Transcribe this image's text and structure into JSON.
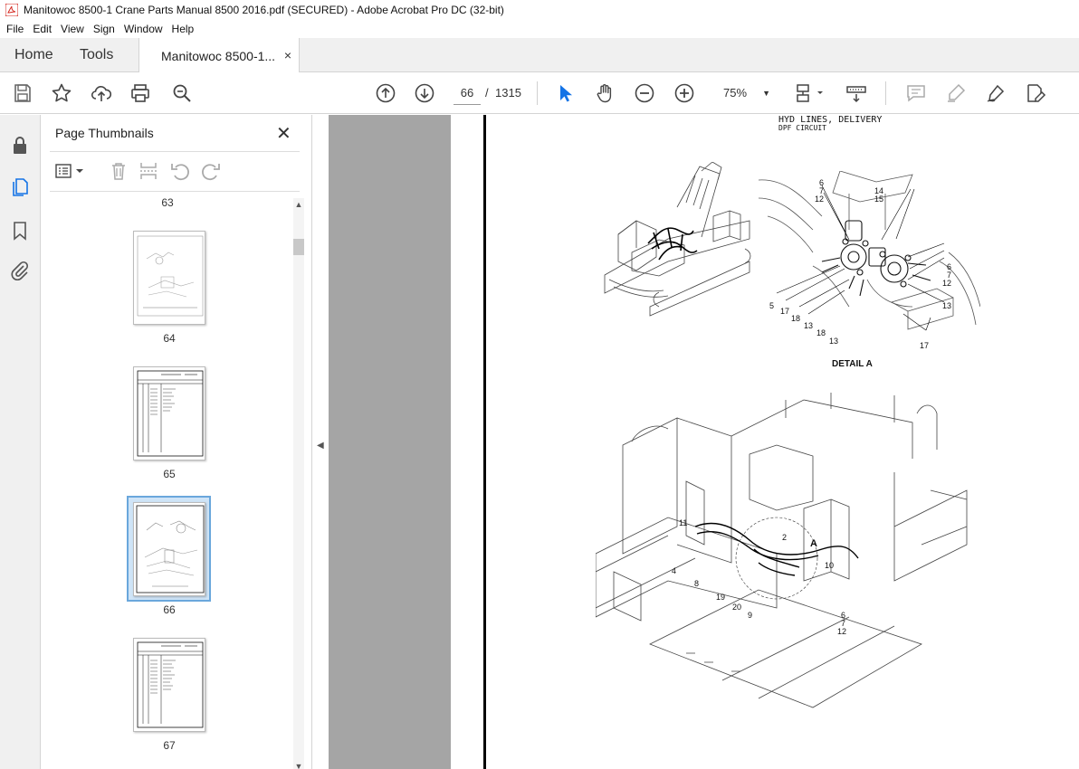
{
  "window": {
    "title": "Manitowoc 8500-1 Crane Parts Manual 8500 2016.pdf (SECURED) - Adobe Acrobat Pro DC (32-bit)"
  },
  "menu": [
    "File",
    "Edit",
    "View",
    "Sign",
    "Window",
    "Help"
  ],
  "tabs": {
    "home": "Home",
    "tools": "Tools",
    "document": "Manitowoc 8500-1...",
    "close_glyph": "×"
  },
  "toolbar": {
    "current_page": "66",
    "separator": "/",
    "total_pages": "1315",
    "zoom": "75%",
    "icons": [
      "save-icon",
      "star-icon",
      "upload-icon",
      "print-icon",
      "zoom-search-icon",
      "page-up-icon",
      "page-down-icon",
      "select-arrow-icon",
      "hand-icon",
      "zoom-out-icon",
      "zoom-in-icon",
      "page-display-icon",
      "scroll-mode-icon",
      "comment-icon",
      "highlight-icon",
      "sign-icon",
      "edit-pdf-icon"
    ]
  },
  "left_rail": {
    "icons": [
      "lock-icon",
      "page-thumbnails-icon",
      "bookmark-icon",
      "attachment-icon"
    ]
  },
  "thumbnail_panel": {
    "title": "Page Thumbnails",
    "close_glyph": "✕",
    "pages": [
      {
        "label": "63",
        "kind": "label-only"
      },
      {
        "label": "64",
        "kind": "drawing"
      },
      {
        "label": "65",
        "kind": "table"
      },
      {
        "label": "66",
        "kind": "drawing",
        "selected": true
      },
      {
        "label": "67",
        "kind": "table"
      }
    ]
  },
  "document": {
    "header_line1": "HYD LINES, DELIVERY",
    "header_line2": "DPF CIRCUIT",
    "detail_label": "DETAIL A",
    "detail_callouts": [
      "6",
      "7",
      "12",
      "14",
      "15",
      "6",
      "7",
      "12",
      "5",
      "17",
      "18",
      "13",
      "18",
      "13",
      "13",
      "17"
    ],
    "main_callouts": [
      "11",
      "2",
      "A",
      "4",
      "8",
      "10",
      "19",
      "20",
      "9",
      "6",
      "7",
      "12"
    ]
  },
  "colors": {
    "acrobat_red": "#d4271f",
    "select_blue": "#1473e6",
    "thumb_selected_bg": "#cfe4f7",
    "doc_gray": "#a5a5a5"
  }
}
